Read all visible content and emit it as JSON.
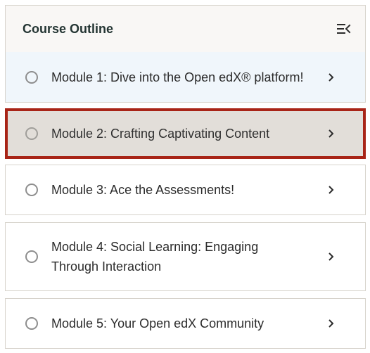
{
  "header": {
    "title": "Course Outline",
    "collapse_icon": "collapse-sidebar-icon"
  },
  "modules": [
    {
      "label": "Module 1: Dive into the Open edX® platform!",
      "state": "not-started"
    },
    {
      "label": "Module 2: Crafting Captivating Content",
      "state": "not-started"
    },
    {
      "label": "Module 3: Ace the Assessments!",
      "state": "not-started"
    },
    {
      "label": "Module 4: Social Learning: Engaging Through Interaction",
      "state": "not-started"
    },
    {
      "label": "Module 5: Your Open edX Community",
      "state": "not-started"
    }
  ],
  "colors": {
    "header_bg": "#f9f7f5",
    "active_bg": "#f0f6fb",
    "hover_bg": "#e2ded9",
    "highlight_border": "#a82417"
  }
}
